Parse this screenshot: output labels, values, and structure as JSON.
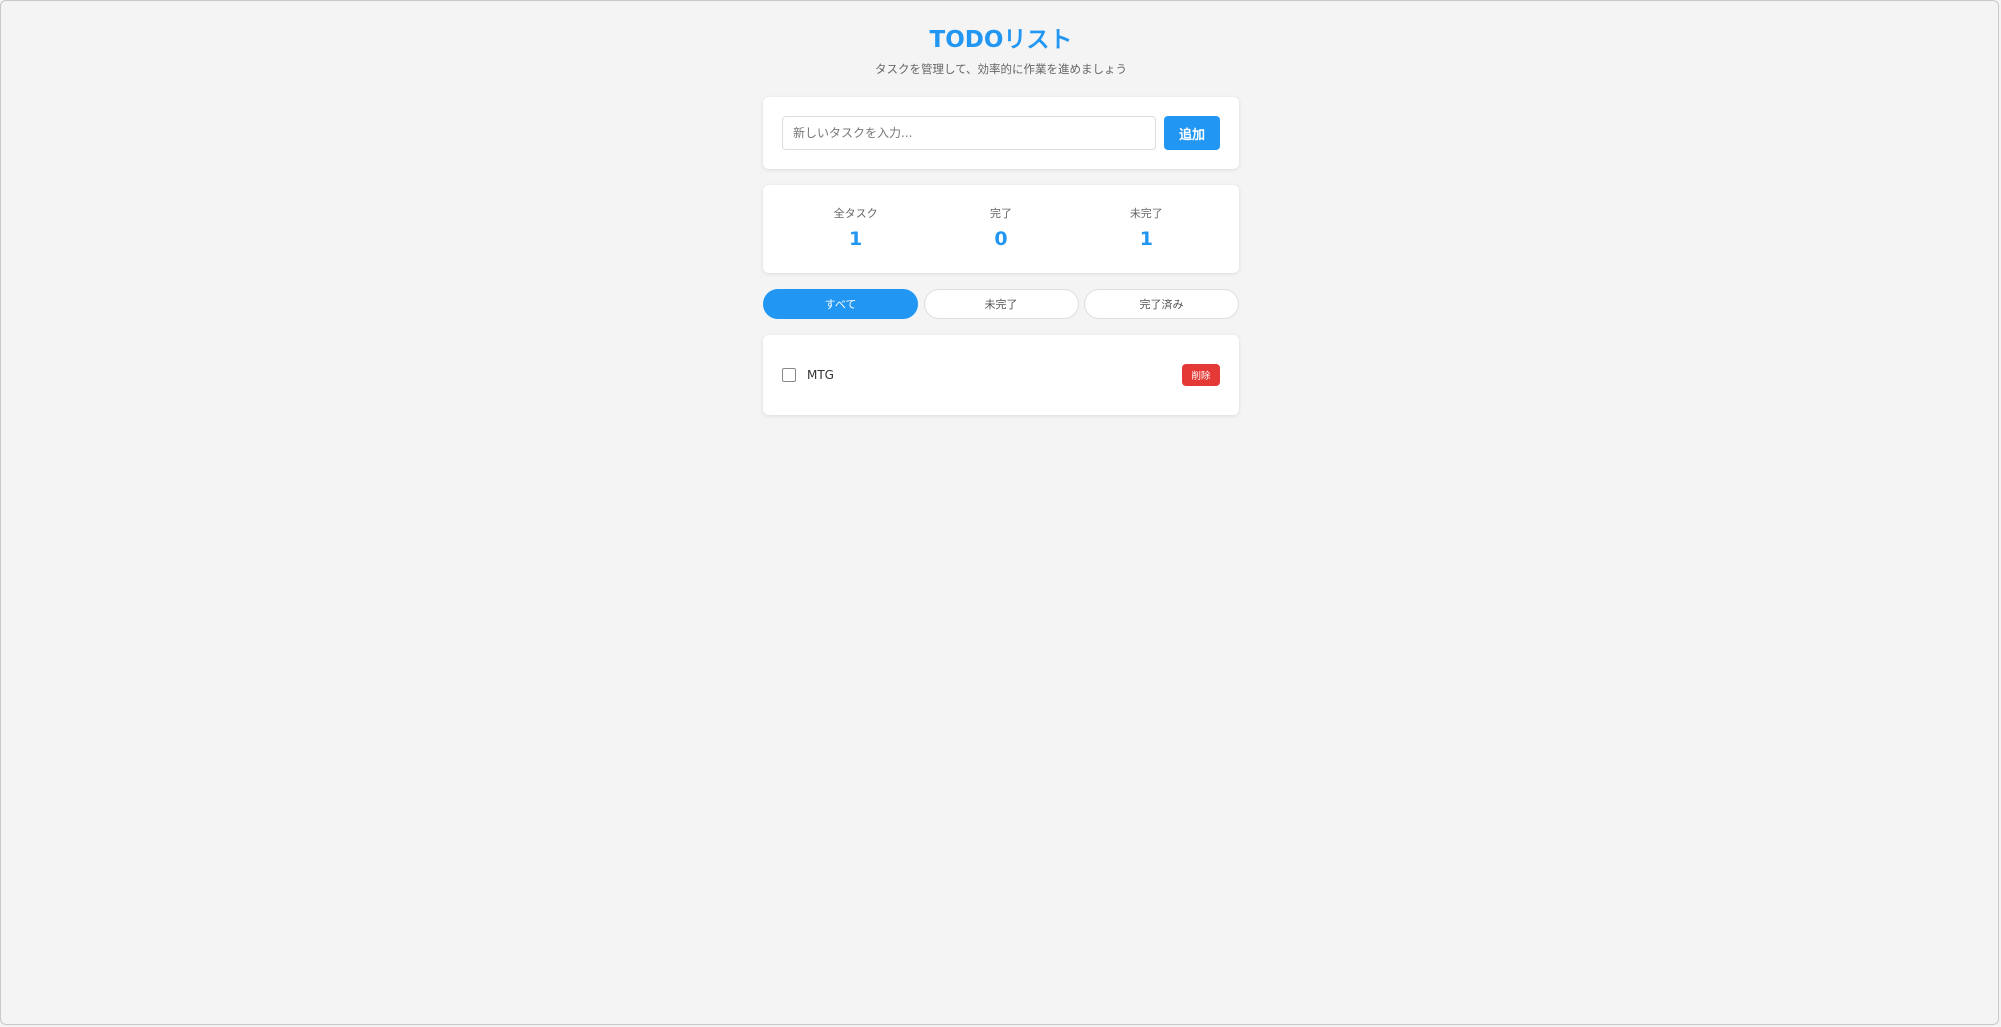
{
  "header": {
    "title": "TODOリスト",
    "subtitle": "タスクを管理して、効率的に作業を進めましょう"
  },
  "input": {
    "placeholder": "新しいタスクを入力...",
    "value": "",
    "add_label": "追加"
  },
  "stats": [
    {
      "label": "全タスク",
      "value": "1"
    },
    {
      "label": "完了",
      "value": "0"
    },
    {
      "label": "未完了",
      "value": "1"
    }
  ],
  "filters": [
    {
      "label": "すべて",
      "active": true
    },
    {
      "label": "未完了",
      "active": false
    },
    {
      "label": "完了済み",
      "active": false
    }
  ],
  "todos": [
    {
      "text": "MTG",
      "completed": false,
      "delete_label": "削除"
    }
  ],
  "colors": {
    "accent": "#2196f3",
    "danger": "#e53935",
    "background": "#f4f4f4"
  }
}
